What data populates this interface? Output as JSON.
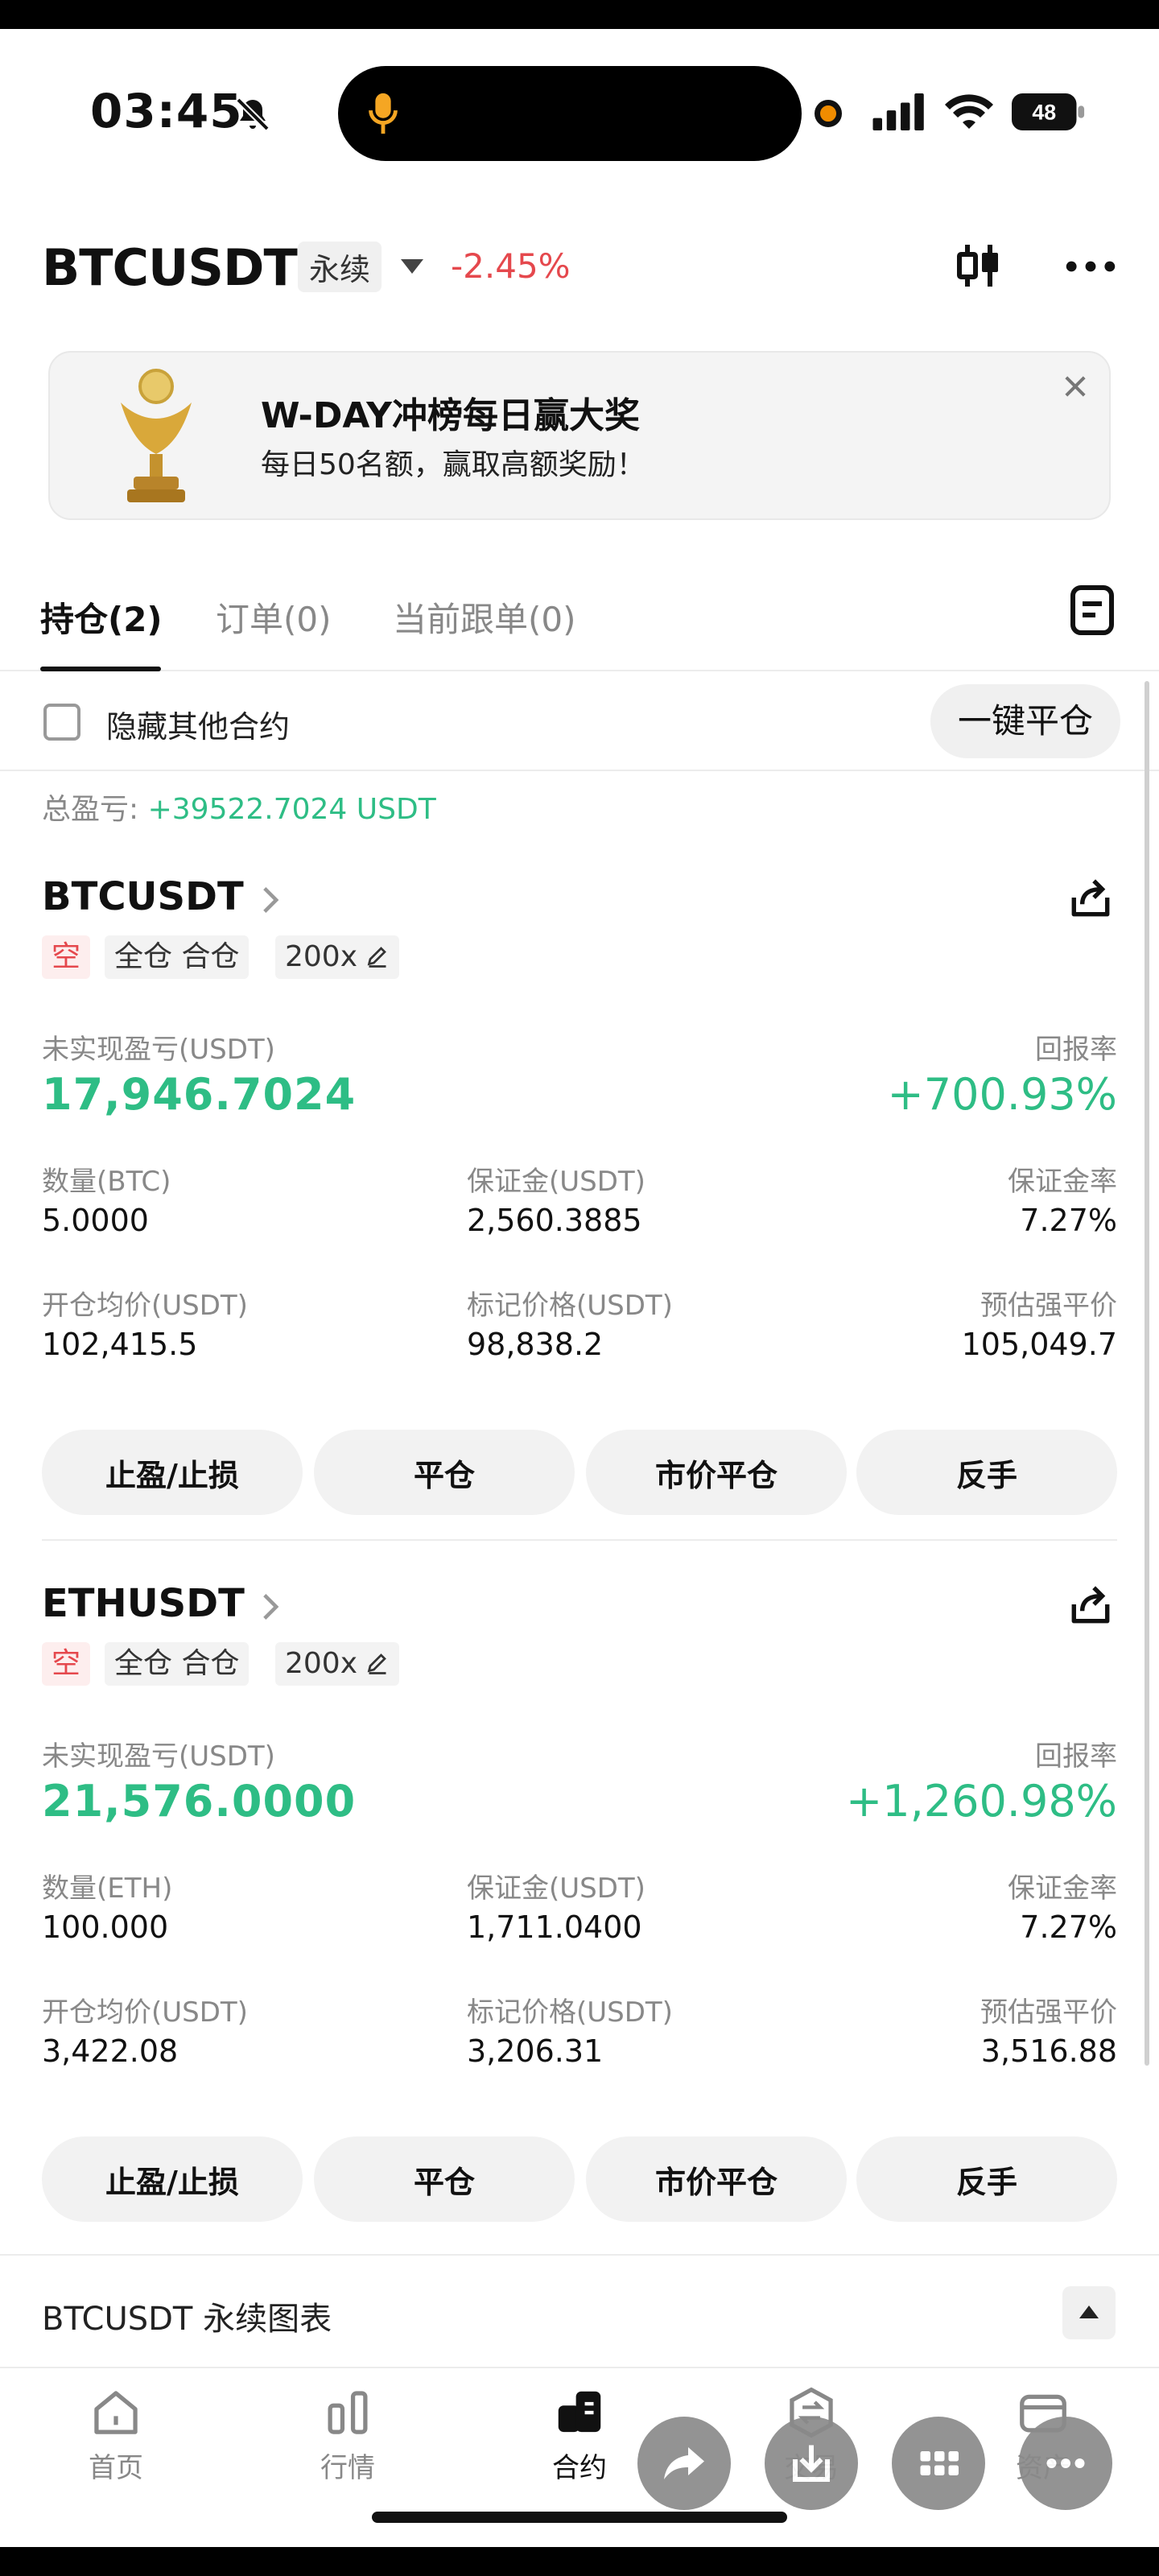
{
  "status_bar": {
    "time": "03:45",
    "battery": "48"
  },
  "header": {
    "pair": "BTCUSDT",
    "contract_type": "永续",
    "change": "-2.45%"
  },
  "banner": {
    "title": "W-DAY冲榜每日赢大奖",
    "subtitle": "每日50名额，赢取高额奖励！"
  },
  "tabs": [
    {
      "label": "持仓(2)",
      "active": true
    },
    {
      "label": "订单(0)",
      "active": false
    },
    {
      "label": "当前跟单(0)",
      "active": false
    }
  ],
  "filter": {
    "hide_label": "隐藏其他合约",
    "close_all": "一键平仓"
  },
  "total": {
    "label": "总盈亏:",
    "value": "+39522.7024 USDT"
  },
  "positions": [
    {
      "symbol": "BTCUSDT",
      "side": "空",
      "mode": "全仓 合仓",
      "leverage": "200x",
      "upnl_label": "未实现盈亏(USDT)",
      "upnl": "17,946.7024",
      "roe_label": "回报率",
      "roe": "+700.93%",
      "qty_label": "数量(BTC)",
      "qty": "5.0000",
      "margin_label": "保证金(USDT)",
      "margin": "2,560.3885",
      "margin_rate_label": "保证金率",
      "margin_rate": "7.27%",
      "entry_label": "开仓均价(USDT)",
      "entry": "102,415.5",
      "mark_label": "标记价格(USDT)",
      "mark": "98,838.2",
      "liq_label": "预估强平价",
      "liq": "105,049.7",
      "buttons": [
        "止盈/止损",
        "平仓",
        "市价平仓",
        "反手"
      ]
    },
    {
      "symbol": "ETHUSDT",
      "side": "空",
      "mode": "全仓 合仓",
      "leverage": "200x",
      "upnl_label": "未实现盈亏(USDT)",
      "upnl": "21,576.0000",
      "roe_label": "回报率",
      "roe": "+1,260.98%",
      "qty_label": "数量(ETH)",
      "qty": "100.000",
      "margin_label": "保证金(USDT)",
      "margin": "1,711.0400",
      "margin_rate_label": "保证金率",
      "margin_rate": "7.27%",
      "entry_label": "开仓均价(USDT)",
      "entry": "3,422.08",
      "mark_label": "标记价格(USDT)",
      "mark": "3,206.31",
      "liq_label": "预估强平价",
      "liq": "3,516.88",
      "buttons": [
        "止盈/止损",
        "平仓",
        "市价平仓",
        "反手"
      ]
    }
  ],
  "chart_row": {
    "label": "BTCUSDT 永续图表"
  },
  "nav": [
    {
      "label": "首页",
      "icon": "home-icon"
    },
    {
      "label": "行情",
      "icon": "market-icon"
    },
    {
      "label": "合约",
      "icon": "futures-icon",
      "active": true
    },
    {
      "label": "交易",
      "icon": "trade-icon"
    },
    {
      "label": "资产",
      "icon": "wallet-icon"
    }
  ],
  "colors": {
    "up": "#2ebd85",
    "down": "#e5484d"
  }
}
